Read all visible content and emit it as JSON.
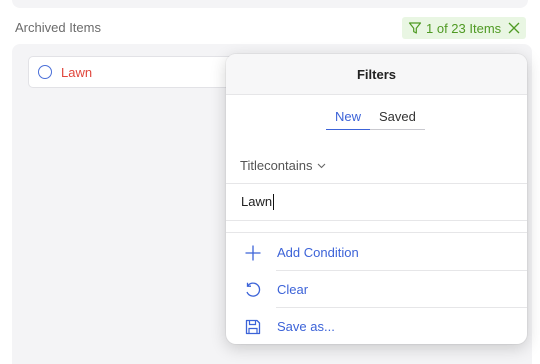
{
  "section": {
    "title": "Archived Items"
  },
  "filter_badge": {
    "text": "1 of 23 Items",
    "color": "#4f9a23",
    "background": "#e9f6e3",
    "icon": "funnel-icon",
    "close_icon": "close-icon"
  },
  "list": {
    "items": [
      {
        "label": "Lawn",
        "label_color": "#e0463c",
        "icon": "circle-icon"
      }
    ]
  },
  "popover": {
    "title": "Filters",
    "tabs": [
      {
        "label": "New",
        "active": true
      },
      {
        "label": "Saved",
        "active": false
      }
    ],
    "field": {
      "label": "Titlecontains",
      "icon": "chevron-down-icon"
    },
    "value": "Lawn",
    "actions": [
      {
        "label": "Add Condition",
        "icon": "plus-icon"
      },
      {
        "label": "Clear",
        "icon": "undo-icon"
      },
      {
        "label": "Save as...",
        "icon": "save-icon"
      }
    ],
    "accent_color": "#3c63d8"
  }
}
